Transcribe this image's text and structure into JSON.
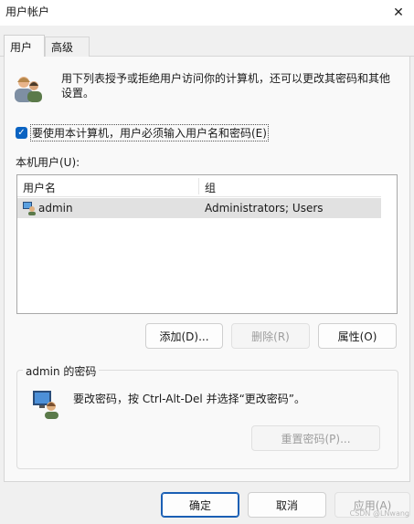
{
  "window": {
    "title": "用户帐户",
    "close_glyph": "✕"
  },
  "tabs": [
    {
      "label": "用户",
      "active": true
    },
    {
      "label": "高级",
      "active": false
    }
  ],
  "intro_text": "用下列表授予或拒绝用户访问你的计算机，还可以更改其密码和其他设置。",
  "require_login": {
    "checked": true,
    "label": "要使用本计算机，用户必须输入用户名和密码(E)"
  },
  "local_users": {
    "label": "本机用户(U):",
    "columns": [
      "用户名",
      "组"
    ],
    "rows": [
      {
        "name": "admin",
        "group": "Administrators; Users",
        "selected": true
      }
    ]
  },
  "user_buttons": {
    "add": "添加(D)...",
    "remove": "删除(R)",
    "properties": "属性(O)"
  },
  "password_group": {
    "title": "admin 的密码",
    "text": "要改密码，按 Ctrl-Alt-Del 并选择“更改密码”。",
    "reset_button": "重置密码(P)..."
  },
  "dialog_buttons": {
    "ok": "确定",
    "cancel": "取消",
    "apply": "应用(A)"
  },
  "watermark": "CSDN @LNwang",
  "colors": {
    "accent": "#0a63c2",
    "selection": "#e1e1e1"
  }
}
